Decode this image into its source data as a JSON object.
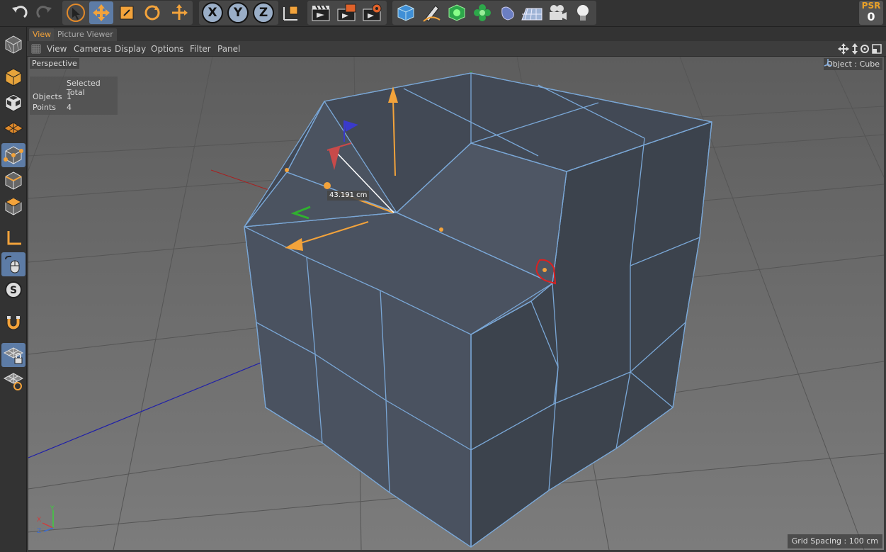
{
  "toolbar": {
    "axis_buttons": [
      "X",
      "Y",
      "Z"
    ],
    "psr_label": "PSR",
    "psr_value": "0"
  },
  "viewport_tabs": [
    {
      "label": "View",
      "active": true
    },
    {
      "label": "Picture Viewer",
      "active": false
    }
  ],
  "view_menu": [
    "View",
    "Cameras",
    "Display",
    "Options",
    "Filter",
    "Panel"
  ],
  "viewport": {
    "camera_label": "Perspective",
    "object_label": "Object : Cube",
    "stats": {
      "header": "Selected Total",
      "rows": [
        {
          "label": "Objects",
          "value": "1"
        },
        {
          "label": "Points",
          "value": "4"
        }
      ]
    },
    "measure_label": "43.191 cm",
    "grid_spacing": "Grid Spacing : 100 cm",
    "axis_labels": {
      "y": "Y",
      "x": "X",
      "z": "Z"
    }
  },
  "colors": {
    "accent": "#f3a33b",
    "active_button": "#5d7ca6",
    "cube_face": "#4a5260",
    "edge": "#7aa7d6"
  }
}
